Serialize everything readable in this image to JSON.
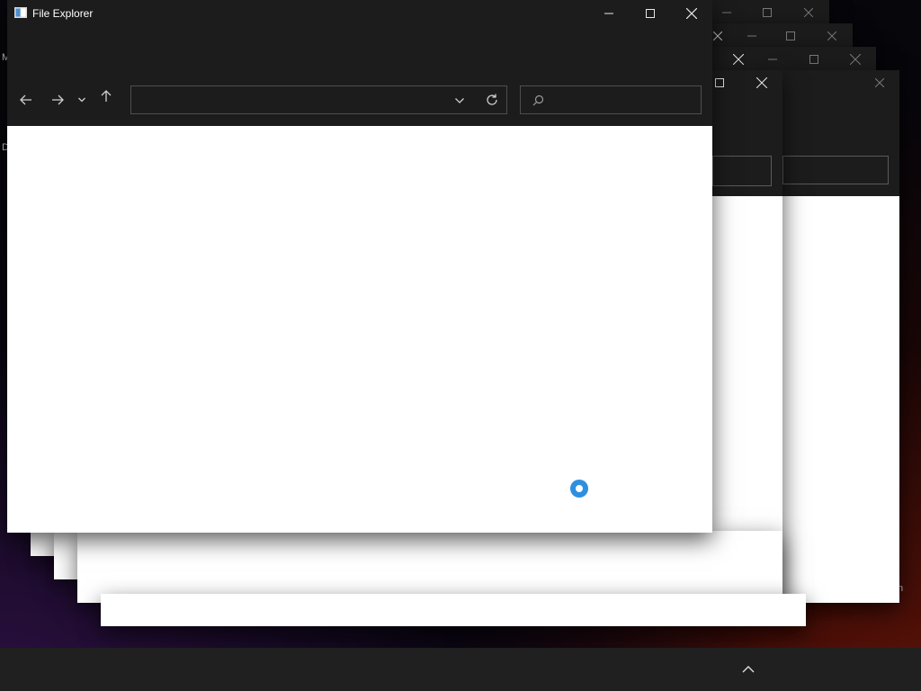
{
  "desktop": {
    "left_marks": [
      "M",
      "D"
    ],
    "right_mark": "n"
  },
  "main_window": {
    "title": "File Explorer",
    "controls": {
      "minimize": "minimize-icon",
      "maximize": "maximize-icon",
      "close": "close-icon"
    },
    "address_value": "",
    "search_placeholder": ""
  },
  "loading": {
    "icon": "loading-spinner-icon",
    "color": "#2e8fe0"
  },
  "colors": {
    "titlebar": "#1c1c1c",
    "content": "#ffffff",
    "taskbar": "#202020"
  }
}
